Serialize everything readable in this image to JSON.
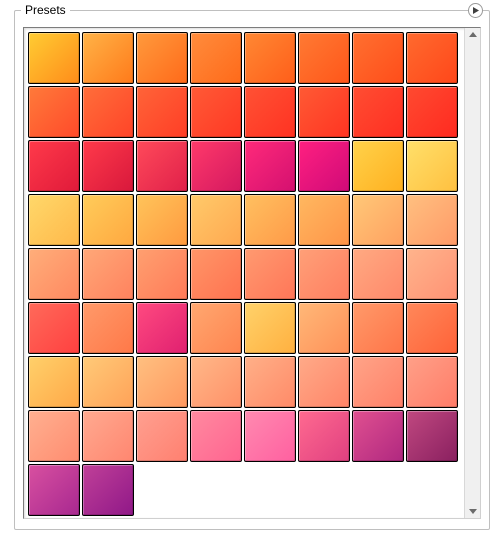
{
  "panel": {
    "title": "Presets"
  },
  "icons": {
    "flyout": "flyout-menu-icon"
  },
  "presets": {
    "columns": 8,
    "swatches": [
      {
        "from": "#ffcc33",
        "to": "#ff8c1a"
      },
      {
        "from": "#ffb347",
        "to": "#ff7a1a"
      },
      {
        "from": "#ff9a3c",
        "to": "#ff6a1a"
      },
      {
        "from": "#ff8c3c",
        "to": "#ff6a1a"
      },
      {
        "from": "#ff8833",
        "to": "#ff5e1a"
      },
      {
        "from": "#ff7a33",
        "to": "#ff561a"
      },
      {
        "from": "#ff7030",
        "to": "#ff4d1a"
      },
      {
        "from": "#ff6a2e",
        "to": "#ff471a"
      },
      {
        "from": "#ff7a3a",
        "to": "#ff4a2a"
      },
      {
        "from": "#ff6e3a",
        "to": "#ff4428"
      },
      {
        "from": "#ff6438",
        "to": "#ff3e26"
      },
      {
        "from": "#ff5a36",
        "to": "#ff3824"
      },
      {
        "from": "#ff5234",
        "to": "#ff3222"
      },
      {
        "from": "#ff5a34",
        "to": "#ff3422"
      },
      {
        "from": "#ff4e32",
        "to": "#ff2e22"
      },
      {
        "from": "#ff4a30",
        "to": "#ff2a20"
      },
      {
        "from": "#ff3a4a",
        "to": "#e01a3a"
      },
      {
        "from": "#ff3a4a",
        "to": "#d8183c"
      },
      {
        "from": "#ff4a5a",
        "to": "#e0204a"
      },
      {
        "from": "#ff3a6a",
        "to": "#d41860"
      },
      {
        "from": "#ff2a7a",
        "to": "#d41070"
      },
      {
        "from": "#ff2080",
        "to": "#d00a78"
      },
      {
        "from": "#ffd24a",
        "to": "#ffb020"
      },
      {
        "from": "#ffe06a",
        "to": "#ffc040"
      },
      {
        "from": "#ffd86a",
        "to": "#ffb84a"
      },
      {
        "from": "#ffcc5a",
        "to": "#ffa840"
      },
      {
        "from": "#ffc45a",
        "to": "#ff9a40"
      },
      {
        "from": "#ffca6a",
        "to": "#ffa850"
      },
      {
        "from": "#ffc060",
        "to": "#ff9a48"
      },
      {
        "from": "#ffb860",
        "to": "#ff9448"
      },
      {
        "from": "#ffc878",
        "to": "#ffa060"
      },
      {
        "from": "#ffc080",
        "to": "#ff9a68"
      },
      {
        "from": "#ffae7a",
        "to": "#ff8860"
      },
      {
        "from": "#ffa878",
        "to": "#ff825e"
      },
      {
        "from": "#ffa070",
        "to": "#ff7a58"
      },
      {
        "from": "#ff9668",
        "to": "#ff7250"
      },
      {
        "from": "#ff9a70",
        "to": "#ff7658"
      },
      {
        "from": "#ffa078",
        "to": "#ff7e60"
      },
      {
        "from": "#ffaa82",
        "to": "#ff886a"
      },
      {
        "from": "#ffb48c",
        "to": "#ff9274"
      },
      {
        "from": "#ff6a5a",
        "to": "#ff4040"
      },
      {
        "from": "#ff9a6a",
        "to": "#ff7848"
      },
      {
        "from": "#ff4a80",
        "to": "#e02070"
      },
      {
        "from": "#ffa870",
        "to": "#ff8450"
      },
      {
        "from": "#ffd26a",
        "to": "#ffb040"
      },
      {
        "from": "#ffb878",
        "to": "#ff9058"
      },
      {
        "from": "#ff9a6a",
        "to": "#ff7448"
      },
      {
        "from": "#ff885a",
        "to": "#ff6238"
      },
      {
        "from": "#ffd06a",
        "to": "#ffa848"
      },
      {
        "from": "#ffca78",
        "to": "#ffa258"
      },
      {
        "from": "#ffc080",
        "to": "#ff9860"
      },
      {
        "from": "#ffb888",
        "to": "#ff9068"
      },
      {
        "from": "#ffb088",
        "to": "#ff8a68"
      },
      {
        "from": "#ffaa88",
        "to": "#ff8468"
      },
      {
        "from": "#ffa488",
        "to": "#ff8068"
      },
      {
        "from": "#ffa088",
        "to": "#ff7c68"
      },
      {
        "from": "#ffb090",
        "to": "#ff8c70"
      },
      {
        "from": "#ffaa90",
        "to": "#ff8670"
      },
      {
        "from": "#ffa090",
        "to": "#ff8070"
      },
      {
        "from": "#ff8aa0",
        "to": "#ff6490"
      },
      {
        "from": "#ff8ab0",
        "to": "#ff60a0"
      },
      {
        "from": "#ff6a90",
        "to": "#e04080"
      },
      {
        "from": "#e05090",
        "to": "#b02880"
      },
      {
        "from": "#c04880",
        "to": "#8a2060"
      },
      {
        "from": "#d850a0",
        "to": "#a82890"
      },
      {
        "from": "#c04098",
        "to": "#901888"
      }
    ]
  }
}
